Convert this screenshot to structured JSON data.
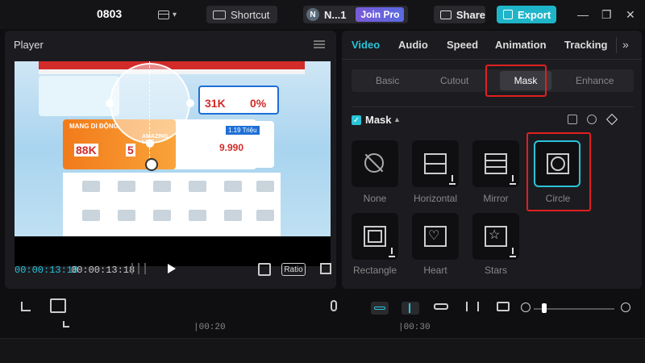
{
  "topbar": {
    "project": "0803",
    "shortcut": "Shortcut",
    "user_initial": "N",
    "user_name": "N...1",
    "join_pro": "Join Pro",
    "share": "Share",
    "export": "Export",
    "win_min": "—",
    "win_max": "❐",
    "win_close": "✕"
  },
  "player": {
    "title": "Player",
    "time_current": "00:00:13:18",
    "time_total": "00:00:13:18",
    "ratio": "Ratio",
    "video_text": {
      "promo_price": "31K",
      "promo_pct": "0%",
      "price1": "88K",
      "price2": "5",
      "watch_price": "9.990",
      "watch_offer": "1.19 Triệu",
      "banner": "MANG DI ĐỘNG",
      "brand": "AMAZING LIFE"
    }
  },
  "panel": {
    "tabs": [
      "Video",
      "Audio",
      "Speed",
      "Animation",
      "Tracking"
    ],
    "active_tab": "Video",
    "more": "»",
    "subtabs": [
      "Basic",
      "Cutout",
      "Mask",
      "Enhance"
    ],
    "active_subtab": "Mask",
    "mask_label": "Mask",
    "options": [
      {
        "label": "None"
      },
      {
        "label": "Horizontal"
      },
      {
        "label": "Mirror"
      },
      {
        "label": "Circle"
      },
      {
        "label": "Rectangle"
      },
      {
        "label": "Heart"
      },
      {
        "label": "Stars"
      }
    ],
    "selected_option": "Circle"
  },
  "timeline": {
    "ruler": [
      "|00:20",
      "|00:30"
    ]
  },
  "colors": {
    "accent": "#2ac4d8",
    "export": "#1fb5c9",
    "highlight": "#e02020"
  }
}
